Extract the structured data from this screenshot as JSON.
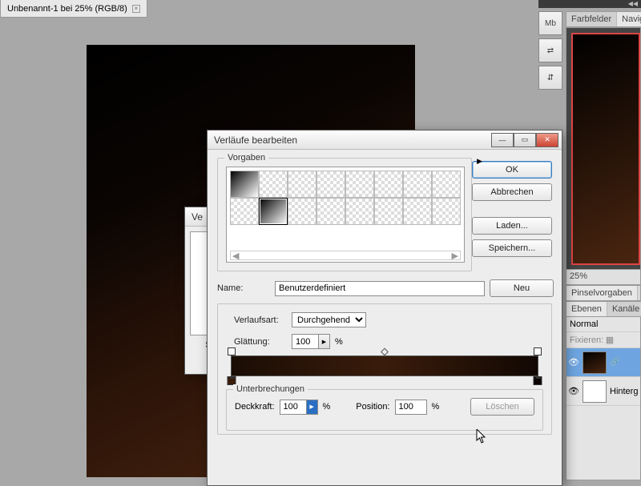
{
  "doc_tab": {
    "title": "Unbenannt-1 bei 25% (RGB/8)",
    "close": "×"
  },
  "dock": {
    "mb": "Mb",
    "b2": "⇄",
    "b3": "⇵"
  },
  "panels": {
    "tabs1": [
      "Farbfelder",
      "Navig"
    ],
    "zoom": "25%",
    "tabs2": [
      "Pinselvorgaben"
    ],
    "tabs3": [
      "Ebenen",
      "Kanäle"
    ],
    "blend_mode": "Normal",
    "lock_label": "Fixieren:",
    "layers": [
      {
        "name": ""
      },
      {
        "name": "Hinterg"
      }
    ]
  },
  "under_dialog": {
    "title": "Ve",
    "inner_label": "S"
  },
  "dialog": {
    "title": "Verläufe bearbeiten",
    "presets_legend": "Vorgaben",
    "buttons": {
      "ok": "OK",
      "cancel": "Abbrechen",
      "load": "Laden...",
      "save": "Speichern...",
      "new": "Neu",
      "delete": "Löschen"
    },
    "name_label": "Name:",
    "name_value": "Benutzerdefiniert",
    "type_label": "Verlaufsart:",
    "type_value": "Durchgehend",
    "smooth_label": "Glättung:",
    "smooth_value": "100",
    "percent": "%",
    "stops_legend": "Unterbrechungen",
    "opacity_label": "Deckkraft:",
    "opacity_value": "100",
    "position_label": "Position:",
    "position_value": "100"
  }
}
